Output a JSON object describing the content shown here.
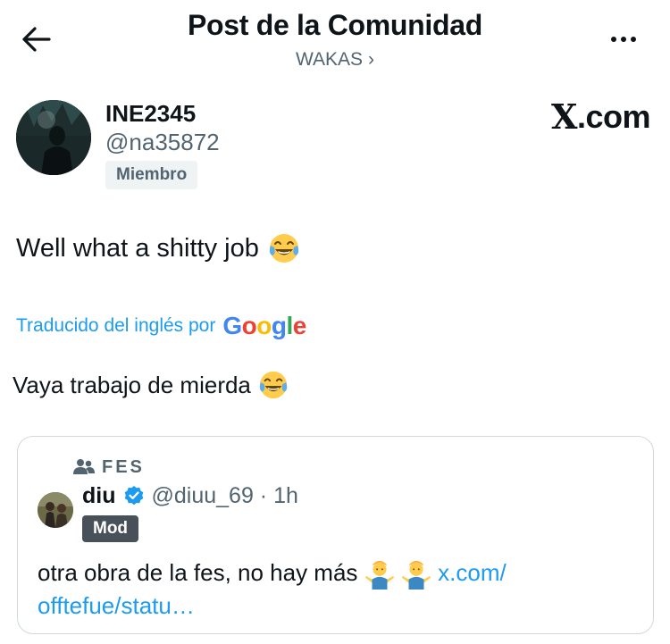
{
  "header": {
    "title": "Post de la Comunidad",
    "subtitle": "WAKAS",
    "subtitle_chevron": "›"
  },
  "author": {
    "name": "INE2345",
    "handle": "@na35872",
    "badge": "Miembro"
  },
  "watermark": "X.com",
  "post": {
    "text": "Well what a shitty job",
    "emoji": "face-with-tears-of-joy-icon"
  },
  "translation": {
    "label": "Traducido del inglés por",
    "provider": "Google",
    "text": "Vaya trabajo de mierda"
  },
  "quote": {
    "community": "FES",
    "name": "diu",
    "verified": true,
    "handle": "@diuu_69 · 1h",
    "badge": "Mod",
    "text": "otra obra de la fes, no hay más",
    "link": "x.com/ offtefue/statu…"
  },
  "colors": {
    "link": "#1d9bf0",
    "secondary_text": "#536471",
    "verified": "#1d9bf0",
    "mod_badge": "#485159",
    "border": "#cfd9de"
  }
}
